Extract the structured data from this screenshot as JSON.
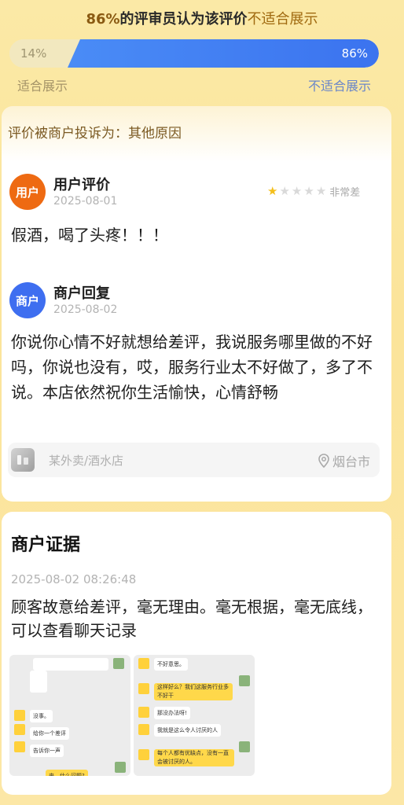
{
  "header": {
    "percent_text": "86%",
    "middle_text": "的评审员认为该评价",
    "verdict_text": "不适合展示"
  },
  "vote": {
    "suitable_percent": 14,
    "unsuitable_percent": 86,
    "suitable_label": "14%",
    "unsuitable_label": "86%",
    "left_caption": "适合展示",
    "right_caption": "不适合展示",
    "colors": {
      "unsuitable": "#4a8cf6",
      "suitable": "#f2e8bf"
    }
  },
  "complaint": {
    "text": "评价被商户投诉为：其他原因"
  },
  "review": {
    "avatar_text": "用户",
    "author": "用户评价",
    "date": "2025-08-01",
    "stars": 1,
    "stars_total": 5,
    "rating_text": "非常差",
    "text": "假酒，喝了头疼！！！"
  },
  "reply": {
    "avatar_text": "商户",
    "author": "商户回复",
    "date": "2025-08-02",
    "text": "你说你心情不好就想给差评，我说服务哪里做的不好吗，你说也没有，哎，服务行业太不好做了，多了不说。本店依然祝你生活愉快，心情舒畅"
  },
  "store": {
    "icon": "store-logo-icon",
    "name": "某外卖/酒水店",
    "location": "烟台市",
    "location_icon": "location-pin-icon"
  },
  "evidence": {
    "title": "商户证据",
    "time": "2025-08-02 08:26:48",
    "text": "顾客故意给差评，毫无理由。毫无根据，毫无底线，可以查看聊天记录",
    "screenshot1": {
      "bubbles": [
        "没事。",
        "给你一个差评",
        "告诉你一声",
        "来，什么问题?"
      ]
    },
    "screenshot2": {
      "bubbles": [
        "不好意思。",
        "这样好么？我们这服务行业多不好干",
        "那没办法呀!",
        "我就是这么令人讨厌的人",
        "每个人都有优缺点，没有一直会被讨厌的人。"
      ]
    }
  }
}
